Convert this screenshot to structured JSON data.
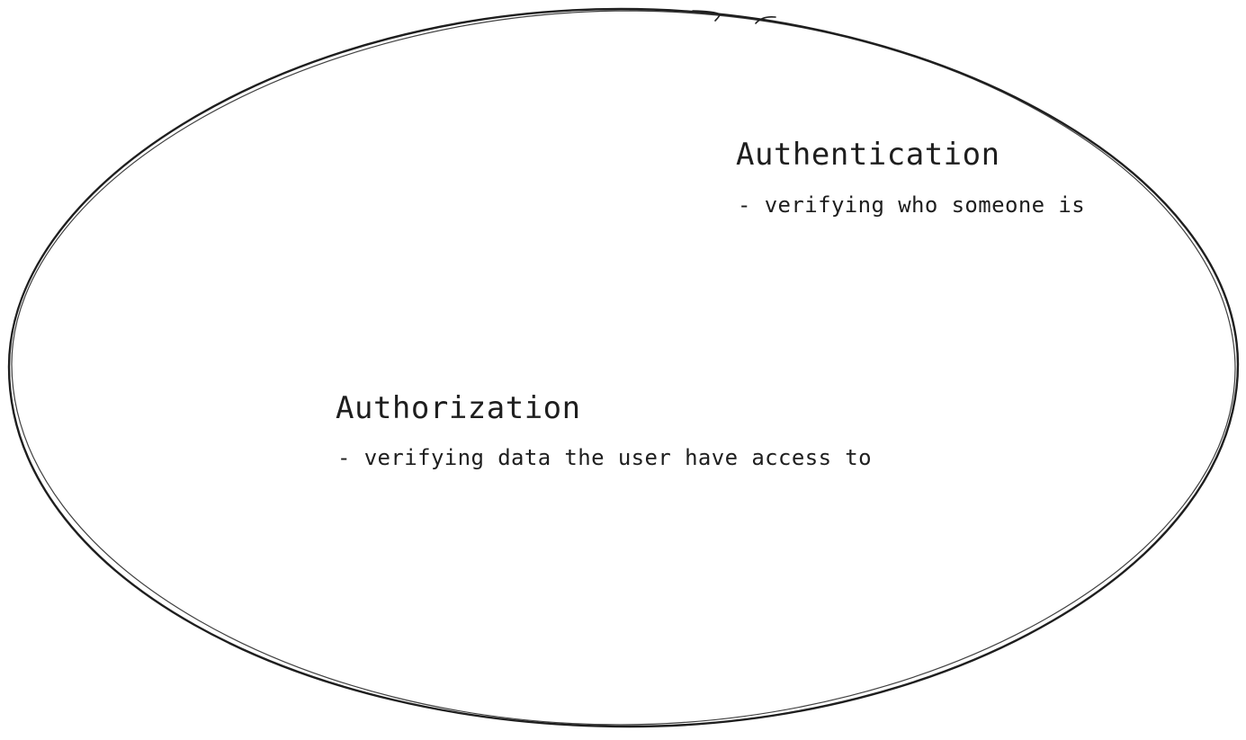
{
  "authentication": {
    "title": "Authentication",
    "note": "- verifying who someone is"
  },
  "authorization": {
    "title": "Authorization",
    "note": "- verifying data the user have access to"
  },
  "colors": {
    "stroke": "#1e1e1e",
    "background": "#ffffff",
    "text": "#1e1e1e"
  }
}
